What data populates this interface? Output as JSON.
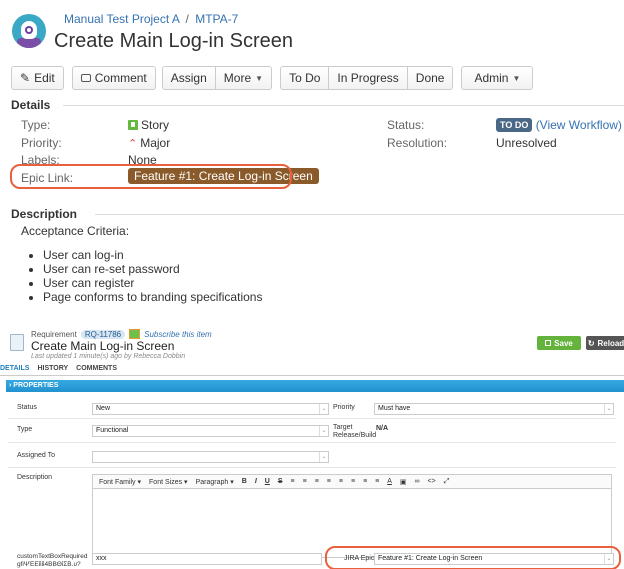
{
  "jira": {
    "breadcrumb_project": "Manual Test Project A",
    "breadcrumb_sep": "/",
    "breadcrumb_issue": "MTPA-7",
    "title": "Create Main Log-in Screen",
    "toolbar": {
      "edit": "Edit",
      "comment": "Comment",
      "assign": "Assign",
      "more": "More",
      "todo": "To Do",
      "in_progress": "In Progress",
      "done": "Done",
      "admin": "Admin"
    },
    "details_heading": "Details",
    "details": {
      "type_label": "Type:",
      "type_value": "Story",
      "priority_label": "Priority:",
      "priority_value": "Major",
      "labels_label": "Labels:",
      "labels_value": "None",
      "epic_label": "Epic Link:",
      "epic_value": "Feature #1: Create Log-in Screen",
      "status_label": "Status:",
      "status_value": "TO DO",
      "status_link": "(View Workflow)",
      "resolution_label": "Resolution:",
      "resolution_value": "Unresolved"
    },
    "description_heading": "Description",
    "description": {
      "intro": "Acceptance Criteria:",
      "items": [
        "User can log-in",
        "User can re-set password",
        "User can register",
        "Page conforms to branding specifications"
      ]
    }
  },
  "app": {
    "req_label": "Requirement",
    "req_id": "RQ-11786",
    "subscribe": "Subscribe this item",
    "title": "Create Main Log-in Screen",
    "updated": "Last updated 1 minute(s) ago by Rebecca Dobbin",
    "save": "Save",
    "reload": "Reload",
    "tabs": [
      "DETAILS",
      "HISTORY",
      "COMMENTS"
    ],
    "properties_bar": "› PROPERTIES",
    "fields": {
      "status_label": "Status",
      "status_value": "New",
      "priority_label": "Priority",
      "priority_value": "Must have",
      "type_label": "Type",
      "type_value": "Functional",
      "target_label_1": "Target",
      "target_label_2": "Release/Build",
      "target_value": "N/A",
      "assigned_label": "Assigned To",
      "assigned_value": "",
      "description_label": "Description",
      "rte_font_family": "Font Family",
      "rte_font_sizes": "Font Sizes",
      "rte_paragraph": "Paragraph",
      "custom_label_1": "customTextBoxRequired",
      "custom_label_2": "gfiΨΈΕὶὶὶὶ4ΒΒΘὶΣΒ.υ?",
      "custom_value": "xxx",
      "jira_epic_label": "JIRA Epic",
      "jira_epic_value": "Feature #1: Create Log-in Screen"
    }
  },
  "colors": {
    "highlight": "#e8603c",
    "jira_link": "#3572b0",
    "epic": "#8b5a2b",
    "todo": "#4a6785",
    "save": "#63b33c",
    "properties": "#2b9cd8"
  }
}
